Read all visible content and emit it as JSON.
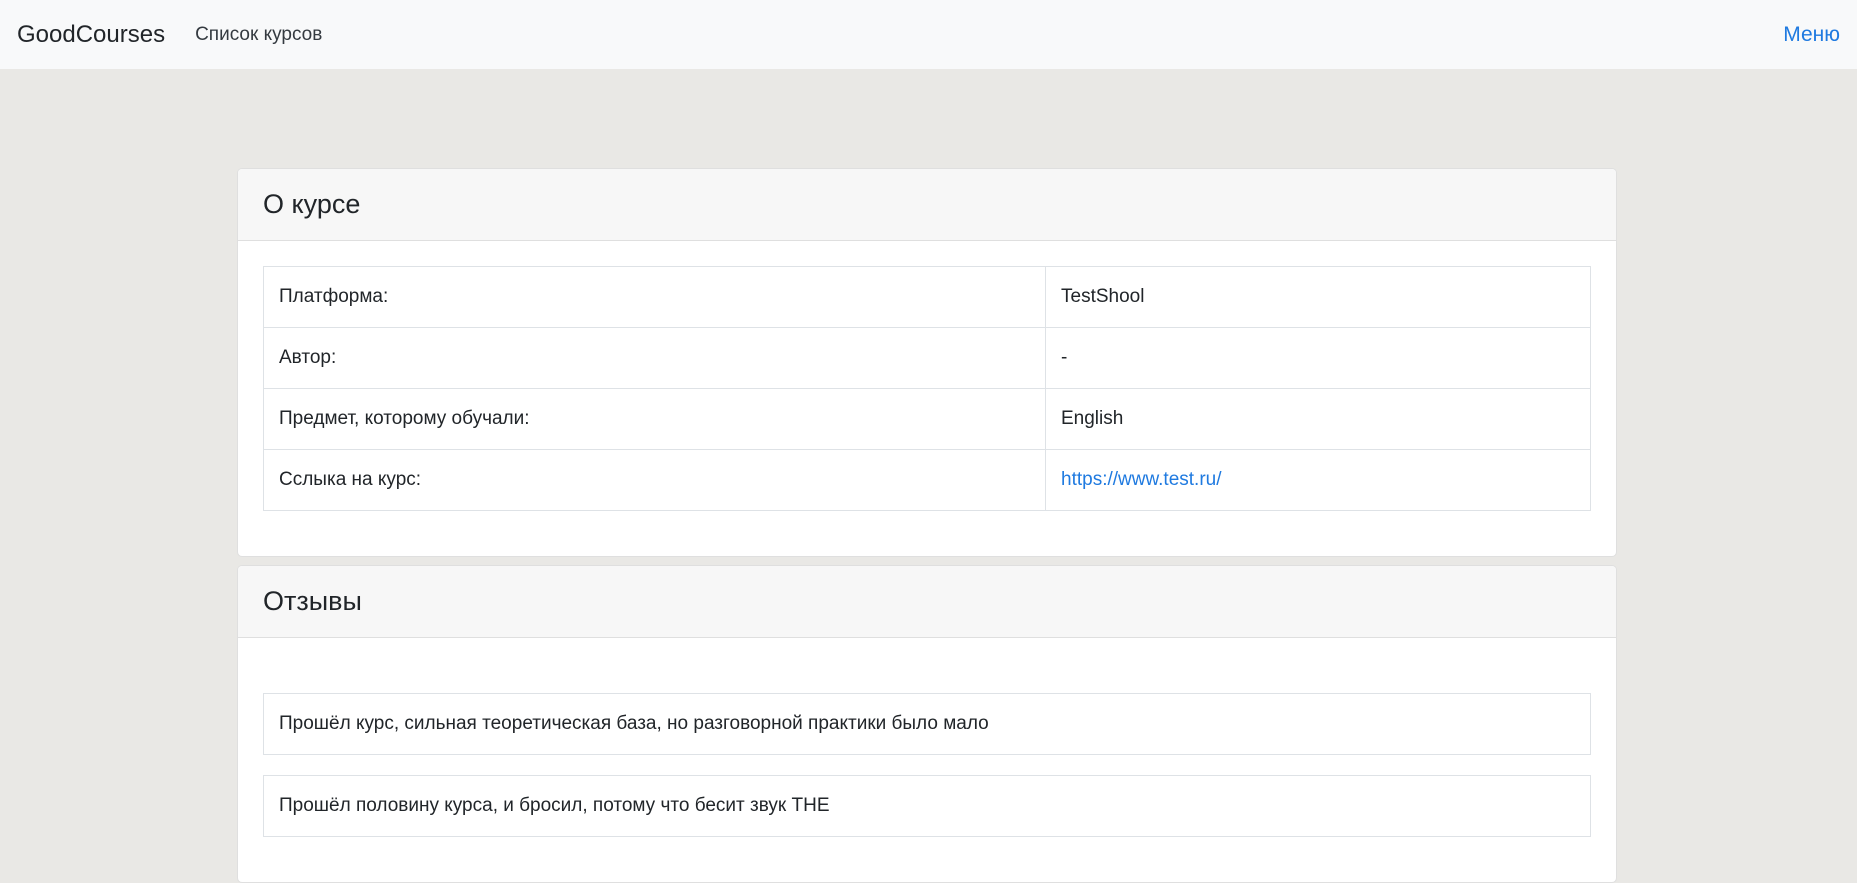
{
  "navbar": {
    "brand": "GoodCourses",
    "courses_link": "Список курсов",
    "menu_link": "Меню"
  },
  "about": {
    "title": "О курсе",
    "rows": [
      {
        "label": "Платформа:",
        "value": "TestShool"
      },
      {
        "label": "Автор:",
        "value": "-"
      },
      {
        "label": "Предмет, которому обучали:",
        "value": "English"
      },
      {
        "label": "Сслыка на курс:",
        "value": "https://www.test.ru/"
      }
    ]
  },
  "reviews": {
    "title": "Отзывы",
    "items": [
      "Прошёл курс, сильная теоретическая база, но разговорной практики было мало",
      "Прошёл половину курса, и бросил, потому что бесит звук THE"
    ]
  },
  "colors": {
    "accent": "#1f7ae0",
    "background": "#e9e8e5",
    "navbar": "#f8f9fa"
  }
}
